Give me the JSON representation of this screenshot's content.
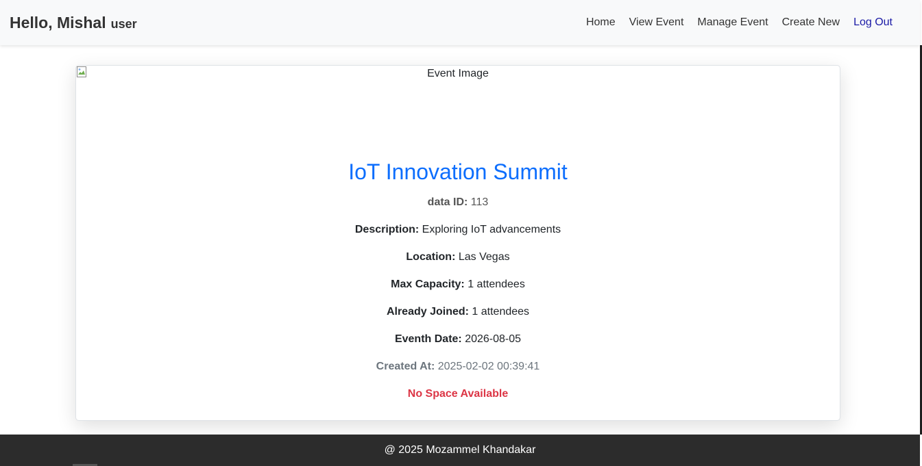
{
  "navbar": {
    "greeting": "Hello, Mishal",
    "role": "user",
    "links": [
      "Home",
      "View Event",
      "Manage Event",
      "Create New",
      "Log Out"
    ]
  },
  "event": {
    "image_alt": "Event Image",
    "title": "IoT Innovation Summit",
    "fields": {
      "data_id": {
        "label": "data ID:",
        "value": "113"
      },
      "description": {
        "label": "Description:",
        "value": "Exploring IoT advancements"
      },
      "location": {
        "label": "Location:",
        "value": "Las Vegas"
      },
      "max_capacity": {
        "label": "Max Capacity:",
        "value": "1 attendees"
      },
      "already_joined": {
        "label": "Already Joined:",
        "value": "1 attendees"
      },
      "event_date": {
        "label": "Eventh Date:",
        "value": "2026-08-05"
      },
      "created_at": {
        "label": "Created At:",
        "value": "2025-02-02 00:39:41"
      }
    },
    "status": "No Space Available"
  },
  "footer": {
    "text": "@ 2025 Mozammel Khandakar"
  },
  "colors": {
    "title": "#0d6efd",
    "status": "#dc3545",
    "logout": "#1a1aa6",
    "footer_bg": "#2c2c2c"
  }
}
